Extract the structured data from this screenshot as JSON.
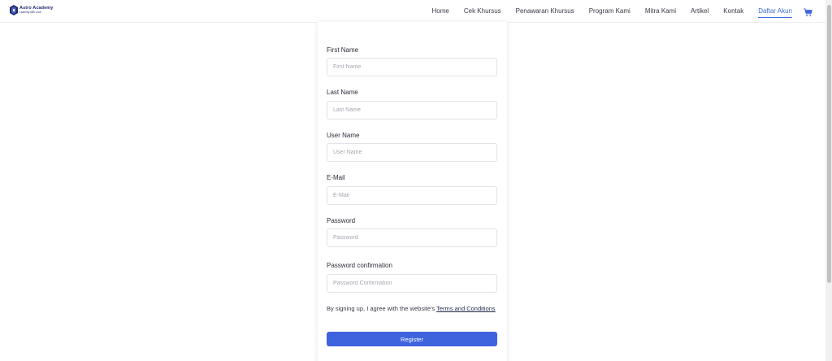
{
  "brand": {
    "name": "Astro Academy",
    "tagline": "Learning with Love"
  },
  "nav": {
    "items": [
      {
        "label": "Home"
      },
      {
        "label": "Cek Khursus"
      },
      {
        "label": "Penawaran Khursus"
      },
      {
        "label": "Program Kami"
      },
      {
        "label": "Mitra Kami"
      },
      {
        "label": "Artikel"
      },
      {
        "label": "Kontak"
      },
      {
        "label": "Daftar Akun",
        "active": true
      }
    ],
    "cart_icon": "cart-icon"
  },
  "form": {
    "fields": [
      {
        "label": "First Name",
        "placeholder": "First Name",
        "value": ""
      },
      {
        "label": "Last Name",
        "placeholder": "Last Name",
        "value": ""
      },
      {
        "label": "User Name",
        "placeholder": "User Name",
        "value": ""
      },
      {
        "label": "E-Mail",
        "placeholder": "E-Mail",
        "value": ""
      },
      {
        "label": "Password",
        "placeholder": "Password",
        "value": ""
      },
      {
        "label": "Password confirmation",
        "placeholder": "Password Confirmation",
        "value": ""
      }
    ],
    "agree_text": "By signing up, I agree with the website's ",
    "terms_link": "Terms and Conditions",
    "submit_label": "Register"
  },
  "colors": {
    "accent": "#3e63dd",
    "active_nav": "#3f6fdc",
    "brand": "#1e2a6b"
  }
}
